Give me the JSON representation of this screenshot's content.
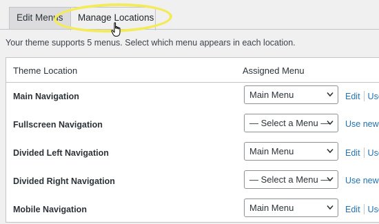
{
  "tabs": {
    "edit_label": "Edit Menus",
    "manage_label": "Manage Locations"
  },
  "intro": "Your theme supports 5 menus. Select which menu appears in each location.",
  "table": {
    "col_location": "Theme Location",
    "col_menu": "Assigned Menu",
    "rows": [
      {
        "location": "Main Navigation",
        "selected": "Main Menu",
        "actions": [
          "Edit",
          "Use"
        ]
      },
      {
        "location": "Fullscreen Navigation",
        "selected": "— Select a Menu —",
        "actions": [
          "Use new m"
        ]
      },
      {
        "location": "Divided Left Navigation",
        "selected": "Main Menu",
        "actions": [
          "Edit",
          "Use"
        ]
      },
      {
        "location": "Divided Right Navigation",
        "selected": "— Select a Menu —",
        "actions": [
          "Use new m"
        ]
      },
      {
        "location": "Mobile Navigation",
        "selected": "Main Menu",
        "actions": [
          "Edit",
          "Use"
        ]
      }
    ]
  },
  "colors": {
    "link": "#2271b1",
    "highlight": "#f3eb5a",
    "page_bg": "#f0f0f1"
  },
  "icons": {
    "cursor": "hand-pointer-icon",
    "dropdown": "chevron-down-icon"
  }
}
